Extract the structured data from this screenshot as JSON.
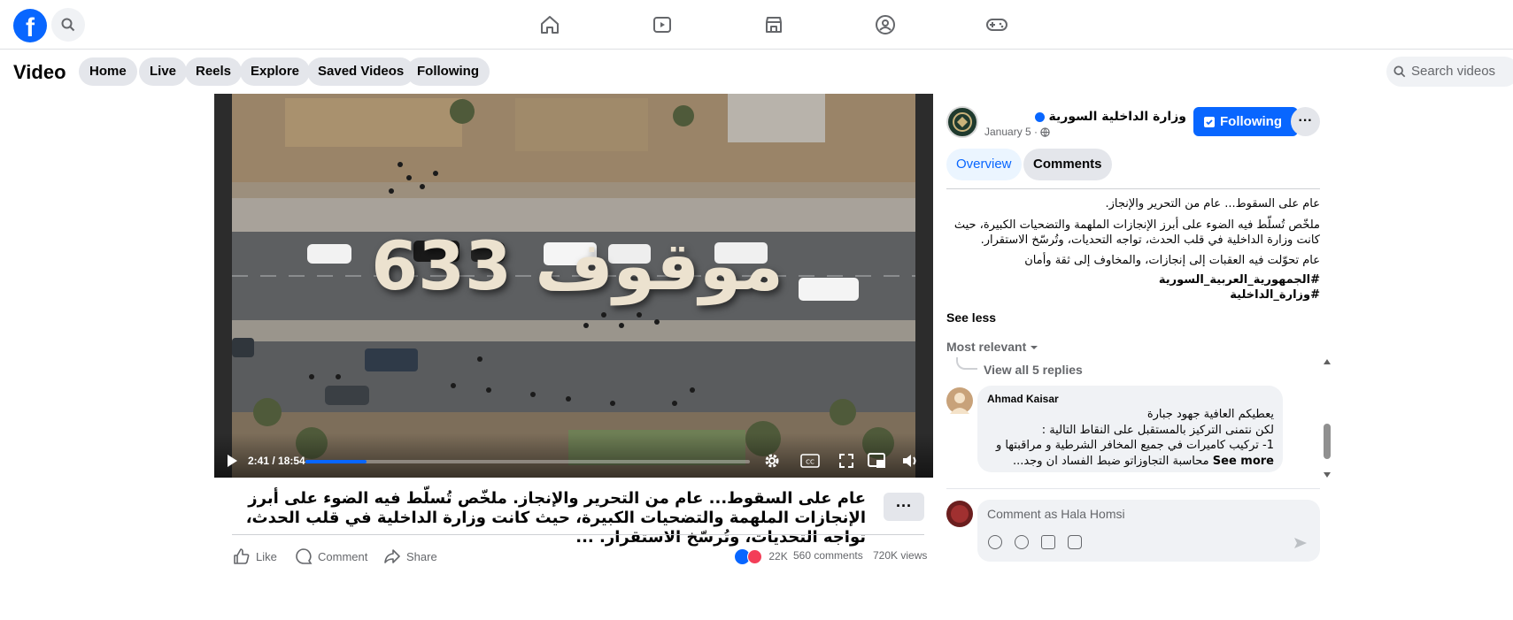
{
  "topnav": {
    "logo": "f",
    "icons": [
      "search-icon",
      "home-icon",
      "video-icon",
      "marketplace-icon",
      "groups-icon",
      "gaming-icon"
    ]
  },
  "video_header": {
    "title": "Video",
    "tabs": [
      "Home",
      "Live",
      "Reels",
      "Explore",
      "Saved Videos",
      "Following"
    ],
    "search_placeholder": "Search videos"
  },
  "player": {
    "overlay_text": "633 موقوف",
    "time": "2:41 / 18:54",
    "progress": 0.138
  },
  "post": {
    "caption": "عام على السقوط... عام من التحرير والإنجاز. ملخّص تُسلّط فيه الضوء على أبرز الإنجازات الملهمة والتضحيات الكبيرة، حيث كانت وزارة الداخلية في قلب الحدث، تواجه التحديات، وتُرسّخ الاستقرار. ...",
    "more_label": "···",
    "actions": {
      "like": "Like",
      "comment": "Comment",
      "share": "Share"
    },
    "reactions_count": "22K",
    "comments_count": "560 comments",
    "views_count": "720K views"
  },
  "panel": {
    "page_name": "وزارة الداخلية السورية",
    "date": "January 5 · ",
    "following_label": "Following",
    "tabs": {
      "overview": "Overview",
      "comments": "Comments"
    },
    "desc_line1": "عام على السقوط... عام من التحرير والإنجاز.",
    "desc_line2": "ملخّص تُسلّط فيه الضوء على أبرز الإنجازات الملهمة والتضحيات الكبيرة، حيث",
    "desc_line3": "كانت وزارة الداخلية في قلب الحدث، تواجه التحديات، وتُرسّخ الاستقرار.",
    "desc_line4": "عام تحوّلت فيه العقبات إلى إنجازات، والمخاوف إلى ثقة وأمان",
    "hashtag1": "#الجمهورية_العربية_السورية",
    "hashtag2": "#وزارة_الداخلية",
    "see_less": "See less",
    "sort_label": "Most relevant",
    "view_replies": "View all 5 replies",
    "comment": {
      "author": "Ahmad Kaisar",
      "line1": "يعطيكم العافية جهود جبارة",
      "line2": "لكن نتمنى التركيز بالمستقبل على النقاط التالية :",
      "line3": "1- تركيب كاميرات في جميع المخافر الشرطية و مراقبتها و",
      "line4": "محاسبة التجاوزاتو ضبط الفساد ان وجد...",
      "see_more": "See more"
    },
    "comment_placeholder": "Comment as Hala Homsi"
  },
  "colors": {
    "brand": "#0866ff",
    "secondary_bg": "#e4e6eb",
    "muted_text": "#65676b"
  }
}
